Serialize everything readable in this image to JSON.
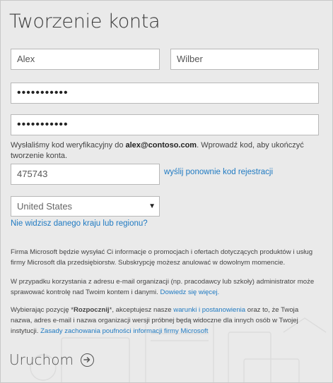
{
  "form": {
    "title": "Tworzenie konta",
    "first_name": "Alex",
    "last_name": "Wilber",
    "password_mask": "•••••••••••",
    "password_confirm_mask": "•••••••••••",
    "verify_prefix": "Wysłaliśmy kod weryfikacyjny do ",
    "verify_email": "alex@contoso.com",
    "verify_suffix": ". Wprowadź kod, aby ukończyć tworzenie konta.",
    "code_value": "475743",
    "resend_link": "wyślij ponownie kod rejestracji",
    "country_value": "United States",
    "country_link": "Nie widzisz danego kraju lub regionu?"
  },
  "legal": {
    "p1": "Firma Microsoft będzie wysyłać Ci informacje o promocjach i ofertach dotyczących produktów i usług firmy Microsoft dla przedsiębiorstw. Subskrypcję możesz anulować w dowolnym momencie.",
    "p2_text": "W przypadku korzystania z adresu e-mail organizacji (np. pracodawcy lub szkoły) administrator może sprawować kontrolę nad Twoim kontem i danymi. ",
    "p2_link": "Dowiedz się więcej.",
    "p3_a": "Wybierając pozycję *",
    "p3_bold": "Rozpocznij",
    "p3_b": "*, akceptujesz nasze ",
    "p3_link1": "warunki i postanowienia",
    "p3_c": " oraz to, że Twoja nazwa, adres e-mail i nazwa organizacji wersji próbnej będą widoczne dla innych osób w Twojej instytucji. ",
    "p3_link2": "Zasady zachowania poufności informacji firmy Microsoft"
  },
  "action": {
    "launch_label": "Uruchom",
    "launch_icon": "arrow-right-circle-icon"
  },
  "colors": {
    "link": "#1f7ac2",
    "background": "#eaeaea",
    "field_border": "#b8b8b8"
  }
}
